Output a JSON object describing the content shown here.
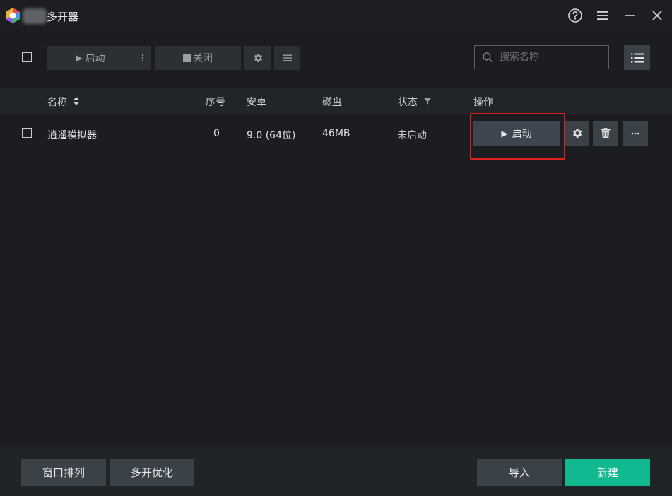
{
  "app": {
    "title": "多开器"
  },
  "toolbar": {
    "start_label": "启动",
    "stop_label": "关闭",
    "search_placeholder": "搜索名称"
  },
  "table": {
    "headers": {
      "name": "名称",
      "index": "序号",
      "android": "安卓",
      "disk": "磁盘",
      "status": "状态",
      "actions": "操作"
    },
    "rows": [
      {
        "name": "逍遥模拟器",
        "index": "0",
        "android": "9.0 (64位)",
        "disk": "46MB",
        "status": "未启动",
        "action_label": "启动"
      }
    ]
  },
  "footer": {
    "arrange_label": "窗口排列",
    "optimize_label": "多开优化",
    "import_label": "导入",
    "new_label": "新建"
  },
  "colors": {
    "background": "#1b1d20",
    "accent_green": "#12b990",
    "highlight_red": "#e0201d",
    "button_gray": "#3a4147"
  },
  "icons": {
    "title": [
      "app-logo-icon",
      "help-icon",
      "menu-icon",
      "minimize-icon",
      "close-icon"
    ],
    "toolbar": [
      "play-icon",
      "more-vertical-icon",
      "stop-icon",
      "gear-icon",
      "list-icon",
      "search-icon",
      "list-view-icon"
    ],
    "row": [
      "play-icon",
      "gear-icon",
      "trash-icon",
      "more-horizontal-icon"
    ],
    "header": [
      "sort-icon",
      "filter-icon"
    ]
  }
}
